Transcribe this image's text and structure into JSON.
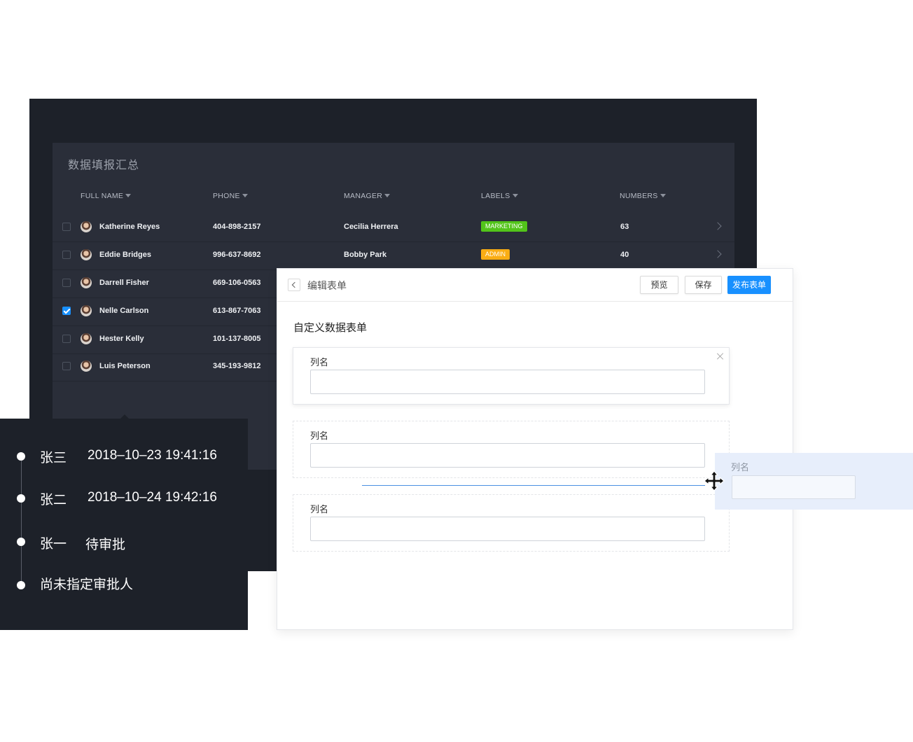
{
  "table": {
    "title": "数据填报汇总",
    "columns": [
      "FULL NAME",
      "PHONE",
      "MANAGER",
      "LABELS",
      "NUMBERS"
    ],
    "rows": [
      {
        "name": "Katherine Reyes",
        "phone": "404-898-2157",
        "manager": "Cecilia Herrera",
        "label": "MARKETING",
        "number": "63",
        "checked": false
      },
      {
        "name": "Eddie Bridges",
        "phone": "996-637-8692",
        "manager": "Bobby Park",
        "label": "ADMIN",
        "number": "40",
        "checked": false
      },
      {
        "name": "Darrell Fisher",
        "phone": "669-106-0563",
        "manager": "",
        "label": "",
        "number": "",
        "checked": false
      },
      {
        "name": "Nelle Carlson",
        "phone": "613-867-7063",
        "manager": "",
        "label": "",
        "number": "",
        "checked": true
      },
      {
        "name": "Hester Kelly",
        "phone": "101-137-8005",
        "manager": "",
        "label": "",
        "number": "",
        "checked": false
      },
      {
        "name": "Luis Peterson",
        "phone": "345-193-9812",
        "manager": "",
        "label": "",
        "number": "",
        "checked": false
      }
    ],
    "label_colors": {
      "MARKETING": "#52c41a",
      "ADMIN": "#faad14"
    }
  },
  "timeline": {
    "items": [
      {
        "name": "张三",
        "value": "2018–10–23 19:41:16"
      },
      {
        "name": "张二",
        "value": "2018–10–24 19:42:16"
      },
      {
        "name": "张一",
        "value": "待审批"
      },
      {
        "name": "尚未指定审批人",
        "value": ""
      }
    ]
  },
  "form_editor": {
    "title": "编辑表单",
    "buttons": {
      "preview": "预览",
      "save": "保存",
      "publish": "发布表单"
    },
    "heading": "自定义数据表单",
    "fields": [
      {
        "label": "列名",
        "value": ""
      },
      {
        "label": "列名",
        "value": ""
      },
      {
        "label": "列名",
        "value": ""
      }
    ],
    "dragging_field": {
      "label": "列名"
    },
    "icons": {
      "back": "chevron-left-icon",
      "close": "close-icon",
      "move": "move-icon"
    }
  },
  "colors": {
    "primary": "#1890ff",
    "dark_bg": "#1d2129",
    "panel_bg": "#2a2e39"
  }
}
